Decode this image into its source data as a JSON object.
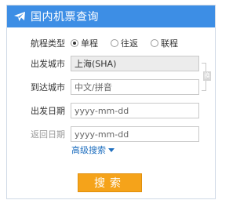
{
  "header": {
    "title": "国内机票查询",
    "icon": "plane-icon"
  },
  "trip_type": {
    "label": "航程类型",
    "options": [
      {
        "label": "单程",
        "checked": true
      },
      {
        "label": "往返",
        "checked": false
      },
      {
        "label": "联程",
        "checked": false
      }
    ]
  },
  "from_city": {
    "label": "出发城市",
    "value": "上海(SHA)",
    "placeholder": ""
  },
  "to_city": {
    "label": "到达城市",
    "value": "",
    "placeholder": "中文/拼音"
  },
  "depart_date": {
    "label": "出发日期",
    "value": "",
    "placeholder": "yyyy-mm-dd"
  },
  "return_date": {
    "label": "返回日期",
    "value": "",
    "placeholder": "yyyy-mm-dd"
  },
  "swap": {
    "label": "换"
  },
  "advanced_search": {
    "label": "高级搜索"
  },
  "search_button": {
    "label": "搜索"
  },
  "colors": {
    "header_bg": "#3d8ee5",
    "search_button_bg": "#f5a31a",
    "link": "#1f6fbf"
  }
}
